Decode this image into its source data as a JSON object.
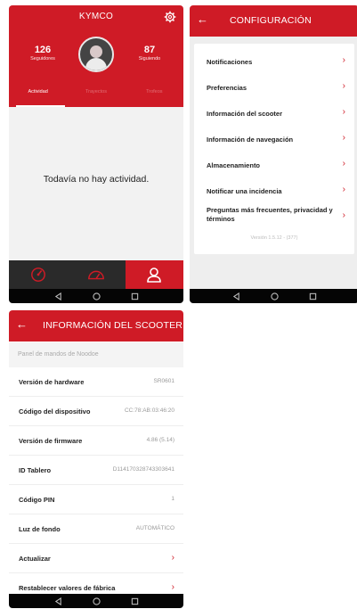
{
  "profile": {
    "title": "KYMCO",
    "followers": {
      "count": "126",
      "label": "Seguidores"
    },
    "following": {
      "count": "87",
      "label": "Siguiendo"
    },
    "tabs": [
      "Actividad",
      "Trayectos",
      "Trofeos"
    ],
    "empty_message": "Todavía no hay actividad.",
    "accent": "#cf1b26",
    "nav_icons": [
      "speedometer-icon",
      "dashboard-icon",
      "user-icon"
    ]
  },
  "config": {
    "title": "CONFIGURACIÓN",
    "items": [
      "Notificaciones",
      "Preferencias",
      "Información del scooter",
      "Información de navegación",
      "Almacenamiento",
      "Notificar una incidencia",
      "Preguntas más frecuentes, privacidad y términos"
    ],
    "version": "Versión 1.5.12 - (377)"
  },
  "scooter": {
    "title": "INFORMACIÓN DEL SCOOTER",
    "section": "Panel de mandos de Noodoe",
    "rows": [
      {
        "label": "Versión de hardware",
        "value": "SR0601"
      },
      {
        "label": "Código del dispositivo",
        "value": "CC:78:AB:03:46:20"
      },
      {
        "label": "Versión de firmware",
        "value": "4.86 (5.14)"
      },
      {
        "label": "ID Tablero",
        "value": "D114170328743303641"
      },
      {
        "label": "Código PIN",
        "value": "1"
      },
      {
        "label": "Luz de fondo",
        "value": "AUTOMÁTICO"
      },
      {
        "label": "Actualizar",
        "value": ""
      },
      {
        "label": "Restablecer valores de fábrica",
        "value": ""
      }
    ]
  }
}
